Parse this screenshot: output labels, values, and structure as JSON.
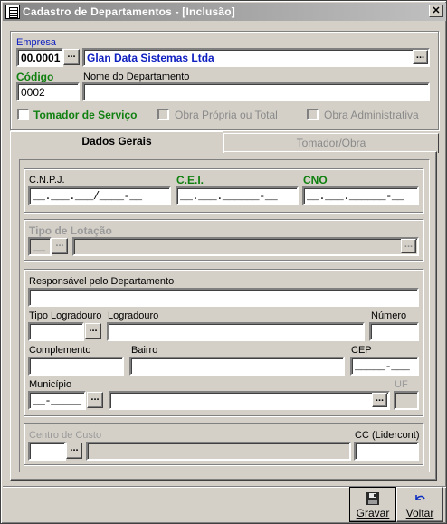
{
  "window": {
    "title": "Cadastro de Departamentos - [Inclusão]",
    "close_glyph": "✕"
  },
  "empresa": {
    "label": "Empresa",
    "code": "00.0001",
    "name": "Glan Data Sistemas Ltda",
    "lookup_glyph": "..."
  },
  "codigo": {
    "label": "Código",
    "value": "0002"
  },
  "nome": {
    "label": "Nome do Departamento",
    "value": ""
  },
  "checks": {
    "tomador": "Tomador de Serviço",
    "obra_propria": "Obra Própria ou Total",
    "obra_adm": "Obra Administrativa"
  },
  "tabs": [
    {
      "label": "Dados Gerais"
    },
    {
      "label": "Tomador/Obra"
    }
  ],
  "dados_gerais": {
    "cnpj": {
      "label": "C.N.P.J.",
      "mask": "__.___.___/____-__"
    },
    "cei": {
      "label": "C.E.I.",
      "mask": "__.___.______-__"
    },
    "cno": {
      "label": "CNO",
      "mask": "__.___.______-__"
    },
    "tipo_lotacao": {
      "label": "Tipo de Lotação",
      "mask": "__"
    },
    "responsavel": {
      "label": "Responsável pelo Departamento",
      "value": ""
    },
    "tipo_logradouro": {
      "label": "Tipo Logradouro"
    },
    "logradouro": {
      "label": "Logradouro"
    },
    "numero": {
      "label": "Número"
    },
    "complemento": {
      "label": "Complemento"
    },
    "bairro": {
      "label": "Bairro"
    },
    "cep": {
      "label": "CEP",
      "mask": "_____-___"
    },
    "municipio": {
      "label": "Município",
      "mask": "__-_____"
    },
    "uf": {
      "label": "UF"
    },
    "centro_custo": {
      "label": "Centro de Custo"
    },
    "cc_lidercont": {
      "label": "CC (Lidercont)"
    }
  },
  "footer": {
    "gravar": {
      "label": "Gravar",
      "icon": "floppy-disk-icon"
    },
    "voltar": {
      "label": "Voltar",
      "icon": "undo-arrow-icon"
    }
  },
  "colors": {
    "label_blue": "#1020c0",
    "label_green": "#108010",
    "disabled": "#9a9a9a",
    "face": "#d4d0c8"
  }
}
